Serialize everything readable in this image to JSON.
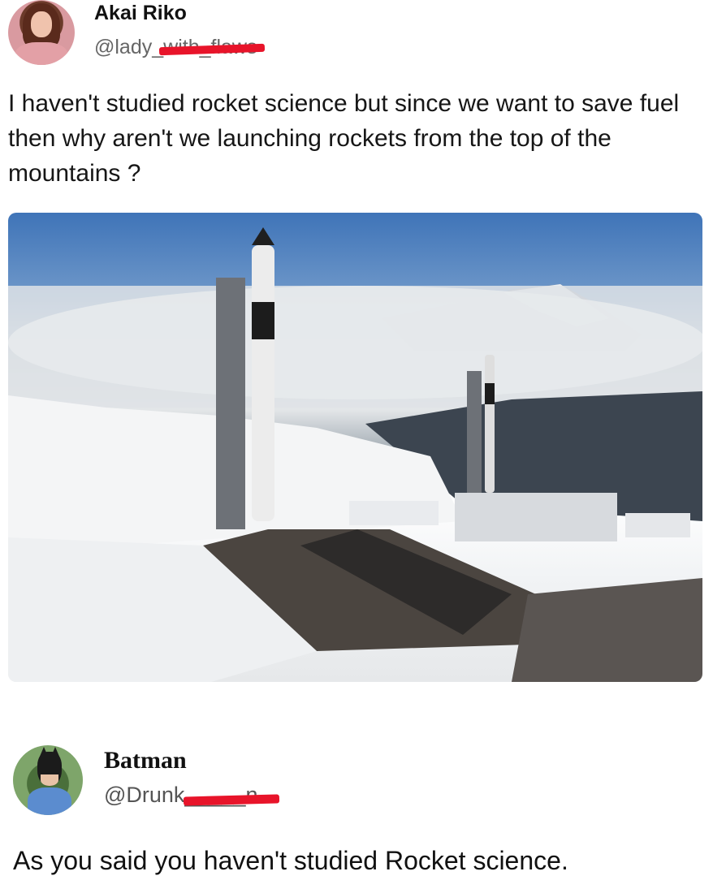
{
  "top_post": {
    "author_name": "Akai Riko",
    "author_handle": "@lady_with_flaws",
    "avatar_icon": "profile-photo",
    "text": "I haven't studied rocket science but since we want to save fuel then why aren't we launching rockets from the top of the mountains ?",
    "image_alt": "rocket launch pad in snowy mountains"
  },
  "reply_post": {
    "author_name": "Batman",
    "author_handle": "@Drunk_____n",
    "avatar_icon": "batman-avatar",
    "text": "As you said you haven't studied Rocket science."
  },
  "colors": {
    "redaction": "#e8142a",
    "text": "#111111",
    "handle": "#666666"
  }
}
